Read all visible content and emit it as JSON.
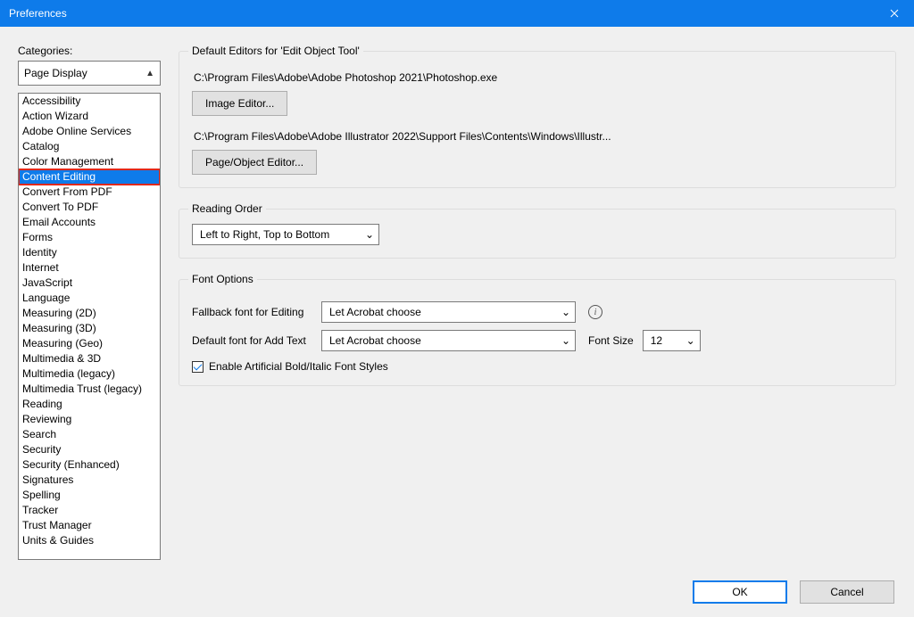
{
  "titlebar": {
    "title": "Preferences"
  },
  "left": {
    "label": "Categories:",
    "dropdown_value": "Page Display",
    "categories": [
      "Accessibility",
      "Action Wizard",
      "Adobe Online Services",
      "Catalog",
      "Color Management",
      "Content Editing",
      "Convert From PDF",
      "Convert To PDF",
      "Email Accounts",
      "Forms",
      "Identity",
      "Internet",
      "JavaScript",
      "Language",
      "Measuring (2D)",
      "Measuring (3D)",
      "Measuring (Geo)",
      "Multimedia & 3D",
      "Multimedia (legacy)",
      "Multimedia Trust (legacy)",
      "Reading",
      "Reviewing",
      "Search",
      "Security",
      "Security (Enhanced)",
      "Signatures",
      "Spelling",
      "Tracker",
      "Trust Manager",
      "Units & Guides"
    ],
    "selected_index": 5
  },
  "editors": {
    "legend": "Default Editors for 'Edit Object Tool'",
    "image_path": "C:\\Program Files\\Adobe\\Adobe Photoshop 2021\\Photoshop.exe",
    "image_btn": "Image Editor...",
    "page_path": "C:\\Program Files\\Adobe\\Adobe Illustrator 2022\\Support Files\\Contents\\Windows\\Illustr...",
    "page_btn": "Page/Object Editor..."
  },
  "reading": {
    "legend": "Reading Order",
    "value": "Left to Right, Top to Bottom"
  },
  "font": {
    "legend": "Font Options",
    "fallback_label": "Fallback font for Editing",
    "fallback_value": "Let Acrobat choose",
    "default_label": "Default font for Add Text",
    "default_value": "Let Acrobat choose",
    "size_label": "Font Size",
    "size_value": "12",
    "enable_artificial_label": "Enable Artificial Bold/Italic Font Styles",
    "enable_artificial_checked": true
  },
  "footer": {
    "ok": "OK",
    "cancel": "Cancel"
  }
}
